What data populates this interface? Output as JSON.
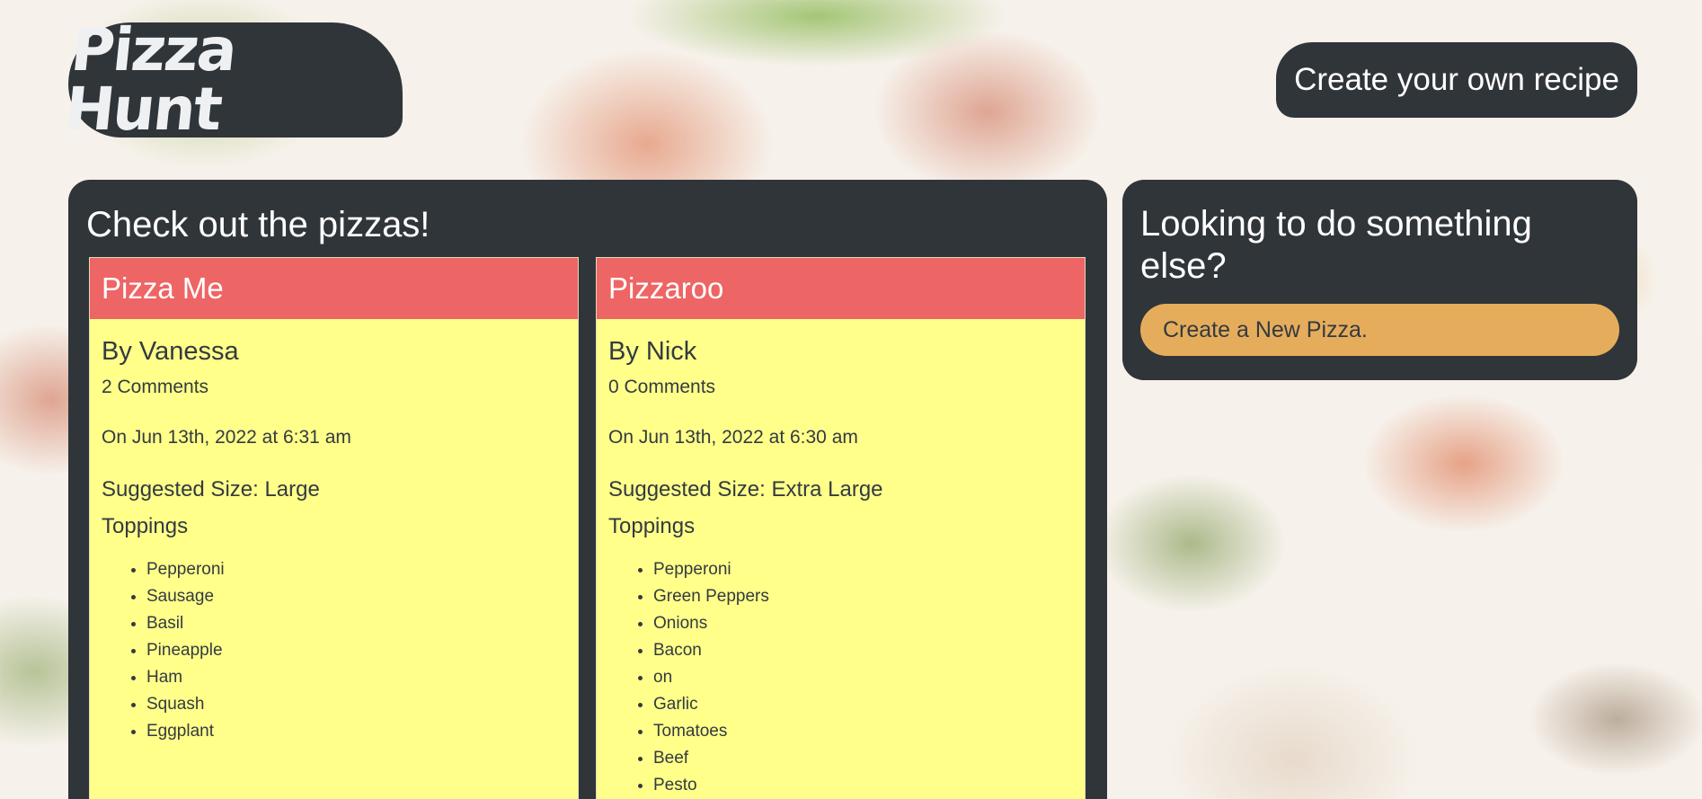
{
  "header": {
    "logo_text": "Pizza Hunt",
    "create_recipe_label": "Create your own recipe"
  },
  "main": {
    "title": "Check out the pizzas!",
    "pizzas": [
      {
        "name": "Pizza Me",
        "author": "By Vanessa",
        "comments": "2 Comments",
        "date": "On Jun 13th, 2022 at 6:31 am",
        "size": "Suggested Size: Large",
        "toppings_label": "Toppings",
        "toppings": [
          "Pepperoni",
          "Sausage",
          "Basil",
          "Pineapple",
          "Ham",
          "Squash",
          "Eggplant"
        ]
      },
      {
        "name": "Pizzaroo",
        "author": "By Nick",
        "comments": "0 Comments",
        "date": "On Jun 13th, 2022 at 6:30 am",
        "size": "Suggested Size: Extra Large",
        "toppings_label": "Toppings",
        "toppings": [
          "Pepperoni",
          "Green Peppers",
          "Onions",
          "Bacon",
          "on",
          "Garlic",
          "Tomatoes",
          "Beef",
          "Pesto"
        ]
      }
    ]
  },
  "side": {
    "title": "Looking to do something else?",
    "button_label": "Create a New Pizza."
  },
  "colors": {
    "panel": "#30353a",
    "card_header": "#ee6565",
    "card_body": "#ffff8a",
    "button": "#e5ad5b"
  }
}
